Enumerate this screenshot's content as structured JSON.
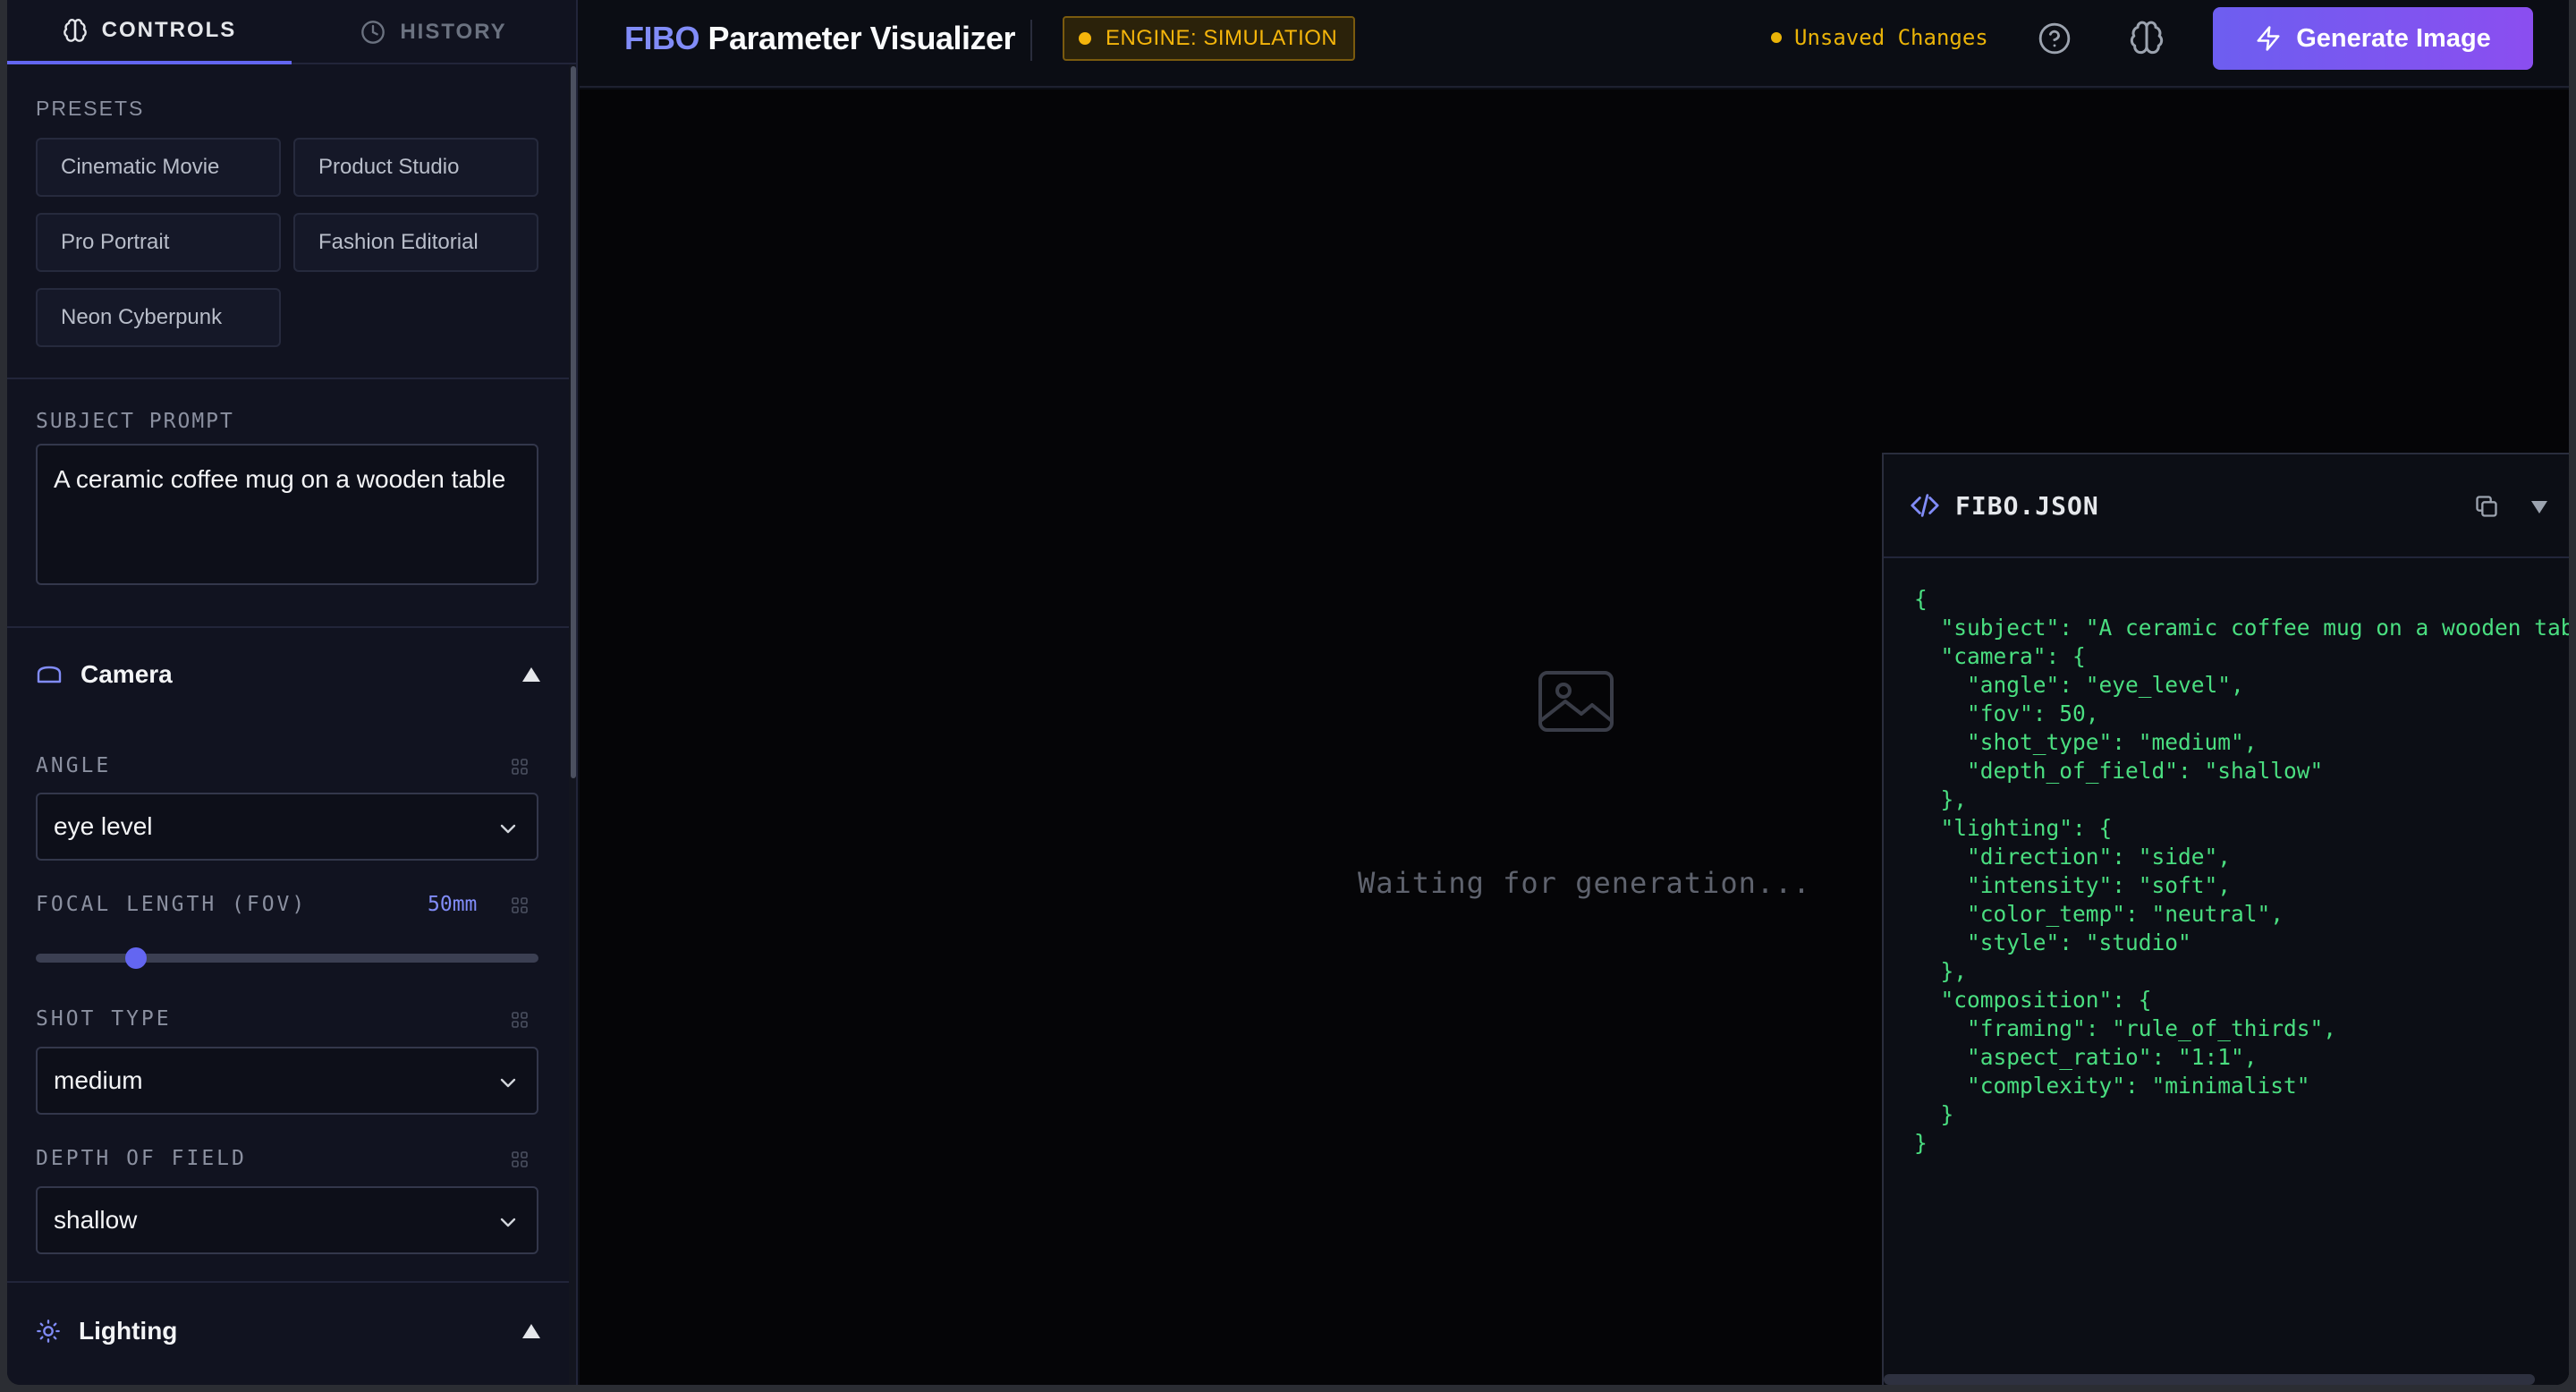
{
  "tabs": {
    "controls": "CONTROLS",
    "history": "HISTORY"
  },
  "presets": {
    "label": "PRESETS",
    "items": [
      "Cinematic Movie",
      "Product Studio",
      "Pro Portrait",
      "Fashion Editorial",
      "Neon Cyberpunk"
    ]
  },
  "subject": {
    "label": "SUBJECT PROMPT",
    "value": "A ceramic coffee mug on a wooden table"
  },
  "camera": {
    "title": "Camera",
    "angle_label": "ANGLE",
    "angle_value": "eye level",
    "fov_label": "FOCAL LENGTH (FOV)",
    "fov_value": "50mm",
    "fov_fraction": 0.2,
    "shot_label": "SHOT TYPE",
    "shot_value": "medium",
    "dof_label": "DEPTH OF FIELD",
    "dof_value": "shallow"
  },
  "lighting": {
    "title": "Lighting"
  },
  "header": {
    "brand_accent": "FIBO",
    "brand_rest": " Parameter Visualizer",
    "engine": "ENGINE: SIMULATION",
    "unsaved": "Unsaved Changes",
    "generate": "Generate Image"
  },
  "canvas": {
    "waiting": "Waiting for generation..."
  },
  "json_panel": {
    "title": "FIBO.JSON",
    "content": "{\n  \"subject\": \"A ceramic coffee mug on a wooden table\",\n  \"camera\": {\n    \"angle\": \"eye_level\",\n    \"fov\": 50,\n    \"shot_type\": \"medium\",\n    \"depth_of_field\": \"shallow\"\n  },\n  \"lighting\": {\n    \"direction\": \"side\",\n    \"intensity\": \"soft\",\n    \"color_temp\": \"neutral\",\n    \"style\": \"studio\"\n  },\n  \"composition\": {\n    \"framing\": \"rule_of_thirds\",\n    \"aspect_ratio\": \"1:1\",\n    \"complexity\": \"minimalist\"\n  }\n}"
  },
  "colors": {
    "accent": "#6366f1",
    "warning": "#f5b50b",
    "json_text": "#4ade80",
    "background": "#0b0d14"
  }
}
